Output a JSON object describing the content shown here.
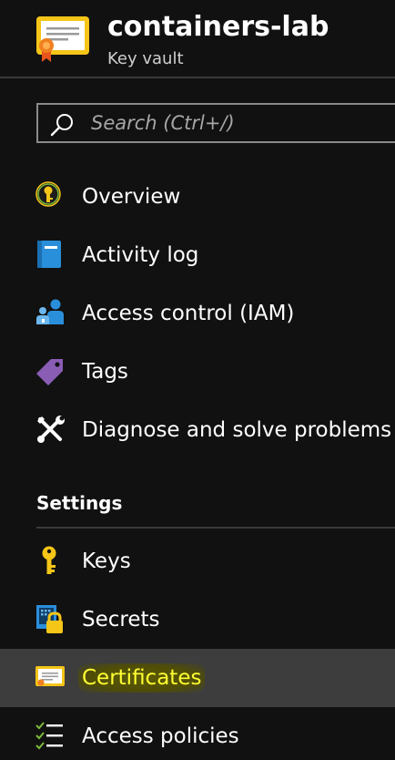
{
  "header": {
    "title": "containers-lab",
    "subtitle": "Key vault",
    "icon": "certificate-icon"
  },
  "search": {
    "placeholder": "Search (Ctrl+/)",
    "value": ""
  },
  "nav": {
    "items": [
      {
        "label": "Overview",
        "icon": "keyvault-icon"
      },
      {
        "label": "Activity log",
        "icon": "activity-log-icon"
      },
      {
        "label": "Access control (IAM)",
        "icon": "iam-icon"
      },
      {
        "label": "Tags",
        "icon": "tag-icon"
      },
      {
        "label": "Diagnose and solve problems",
        "icon": "wrench-icon"
      }
    ]
  },
  "settings": {
    "header": "Settings",
    "items": [
      {
        "label": "Keys",
        "icon": "key-icon"
      },
      {
        "label": "Secrets",
        "icon": "secret-lock-icon"
      },
      {
        "label": "Certificates",
        "icon": "certificate-icon",
        "active": true
      },
      {
        "label": "Access policies",
        "icon": "checklist-icon"
      }
    ]
  },
  "colors": {
    "background": "#111111",
    "active_row": "#3d3d3d",
    "highlight_text": "#ffff33",
    "highlight_bg": "#5c5a05",
    "divider": "#3a3a3a",
    "key_yellow": "#f5c518",
    "blue": "#2a8fdb",
    "purple": "#8a5db5"
  }
}
